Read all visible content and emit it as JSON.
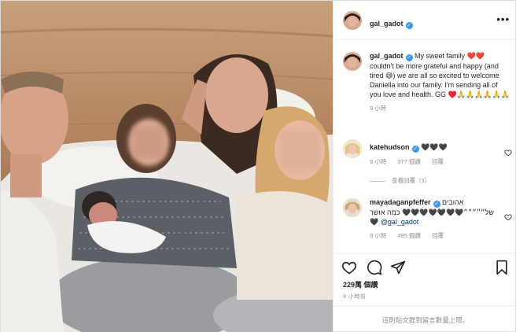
{
  "post": {
    "username": "gal_gadot",
    "more_icon": "more-horizontal-icon"
  },
  "caption": {
    "username": "gal_gadot",
    "text": "My sweet family ❤️❤️ couldn't be more grateful and happy (and tired 😅) we are all so excited to welcome Daniella into our family. I'm sending all of you love and health. GG ♥️🙏🙏🙏🙏🙏🙏",
    "time": "9 小時"
  },
  "comments": [
    {
      "username": "katehudson",
      "text": "🖤🖤🖤",
      "time": "9 小時",
      "likes": "377 個讚",
      "reply": "回覆"
    },
    {
      "username": "mayadaganpfeffer",
      "text_line1": "אהובים",
      "text_line2": "של״״״״״🖤🖤🖤🖤🖤🖤🖤 כמה אושר",
      "text_line3": "🖤 @gal_gadot",
      "time": "9 小時",
      "likes": "495 個讚",
      "reply": "回覆"
    }
  ],
  "view_replies": "查看回覆（3）",
  "actions": {
    "like_icon": "heart-outline-icon",
    "comment_icon": "comment-icon",
    "share_icon": "send-icon",
    "save_icon": "bookmark-icon"
  },
  "likes_count": "229萬 個讚",
  "posted_time": "9 小時前",
  "comments_limit": "這則貼文提到留言數量上限。",
  "colors": {
    "verified": "#3897f0",
    "muted": "#8e8e8e",
    "text": "#262626"
  }
}
